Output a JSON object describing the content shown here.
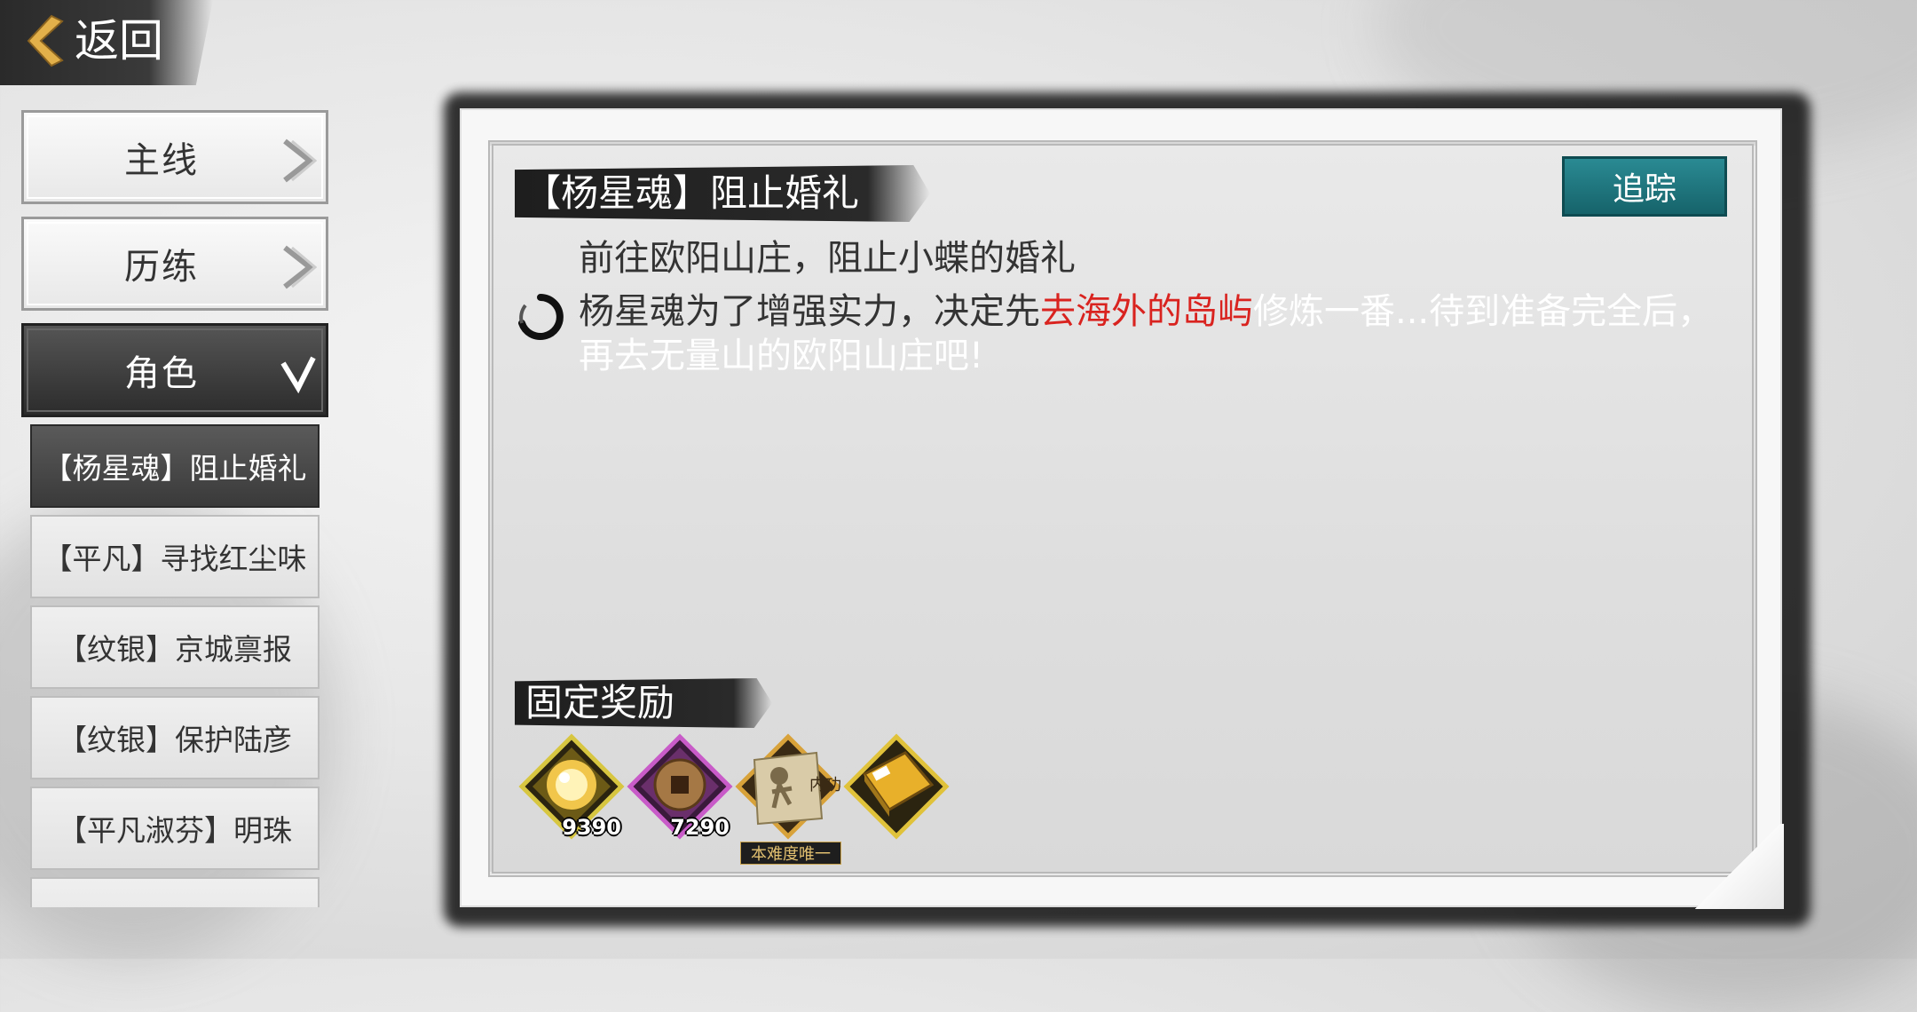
{
  "back": {
    "label": "返回",
    "icon": "chevron-left-icon"
  },
  "menu": [
    {
      "label": "主线",
      "state": "collapsed"
    },
    {
      "label": "历练",
      "state": "collapsed"
    },
    {
      "label": "角色",
      "state": "expanded"
    }
  ],
  "quests": [
    {
      "label": "【杨星魂】阻止婚礼",
      "selected": true
    },
    {
      "label": "【平凡】寻找红尘味"
    },
    {
      "label": "【纹银】京城禀报"
    },
    {
      "label": "【纹银】保护陆彦"
    },
    {
      "label": "【平凡淑芬】明珠"
    }
  ],
  "detail": {
    "title": "【杨星魂】阻止婚礼",
    "track_label": "追踪",
    "goal": "前往欧阳山庄，阻止小蝶的婚礼",
    "desc_part1": "杨星魂为了增强实力，决定先",
    "desc_highlight": "去海外的岛屿",
    "desc_part2": "修炼一番...待到准备完全后，再去无量山的欧阳山庄吧!"
  },
  "rewards": {
    "title": "固定奖励",
    "items": [
      {
        "icon": "golden-orb-icon",
        "count": "9390"
      },
      {
        "icon": "copper-coin-icon",
        "count": "7290"
      },
      {
        "icon": "martial-scroll-icon",
        "count": "",
        "caption": "内功",
        "tag": "本难度唯一"
      },
      {
        "icon": "golden-book-icon",
        "count": ""
      }
    ]
  },
  "colors": {
    "accent_teal": "#1f7c85",
    "highlight_red": "#d9231f",
    "ink": "#2a2a2a"
  }
}
